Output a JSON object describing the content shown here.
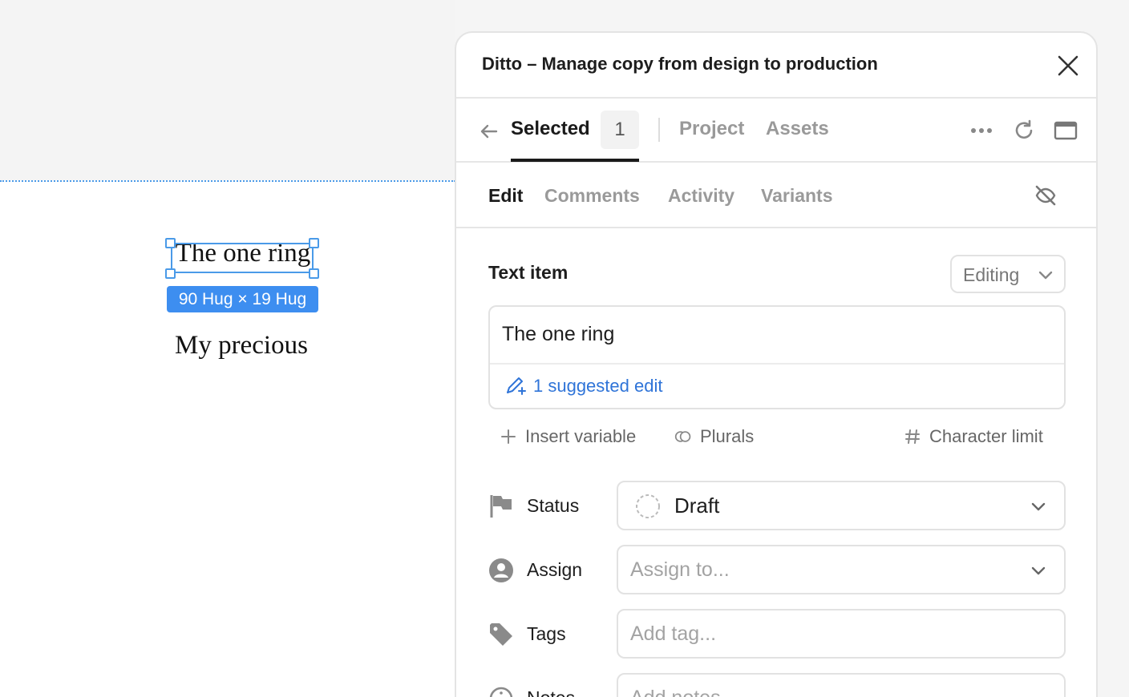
{
  "canvas": {
    "selected_text": "The one ring",
    "size_badge": "90 Hug × 19 Hug",
    "second_text": "My precious"
  },
  "panel": {
    "title": "Ditto – Manage copy from design to production",
    "nav": {
      "selected_label": "Selected",
      "selected_count": "1",
      "project_label": "Project",
      "assets_label": "Assets"
    },
    "subnav": {
      "edit": "Edit",
      "comments": "Comments",
      "activity": "Activity",
      "variants": "Variants"
    },
    "text_item": {
      "label": "Text item",
      "mode": "Editing",
      "value": "The one ring",
      "suggested": "1 suggested edit"
    },
    "tools": {
      "insert_variable": "Insert variable",
      "plurals": "Plurals",
      "character_limit": "Character limit"
    },
    "fields": {
      "status_label": "Status",
      "status_value": "Draft",
      "assign_label": "Assign",
      "assign_placeholder": "Assign to...",
      "tags_label": "Tags",
      "tags_placeholder": "Add tag...",
      "notes_label": "Notes",
      "notes_placeholder": "Add notes..."
    }
  }
}
